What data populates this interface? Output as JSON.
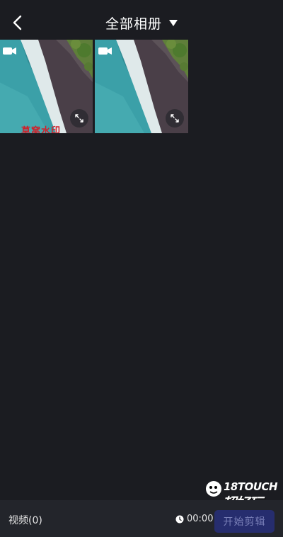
{
  "header": {
    "back_icon": "chevron-left-icon",
    "album_title": "全部相册",
    "dropdown_icon": "triangle-down-icon"
  },
  "media_grid": {
    "items": [
      {
        "type": "video",
        "overlay_text": "草窝水印",
        "icon": "video-camera-icon",
        "action_icon": "expand-icon"
      },
      {
        "type": "video",
        "overlay_text": "",
        "icon": "video-camera-icon",
        "action_icon": "expand-icon"
      }
    ]
  },
  "watermark": {
    "line1": "18TOUCH",
    "line2": "超好玩"
  },
  "footer": {
    "video_count_label": "视频(0)",
    "duration": "00:00",
    "clock_icon": "clock-icon",
    "start_button": "开始剪辑"
  },
  "colors": {
    "background": "#1b1c21",
    "footer_bg": "#23252b",
    "start_button_bg": "#262d6e",
    "start_button_text": "#7a80b8"
  }
}
